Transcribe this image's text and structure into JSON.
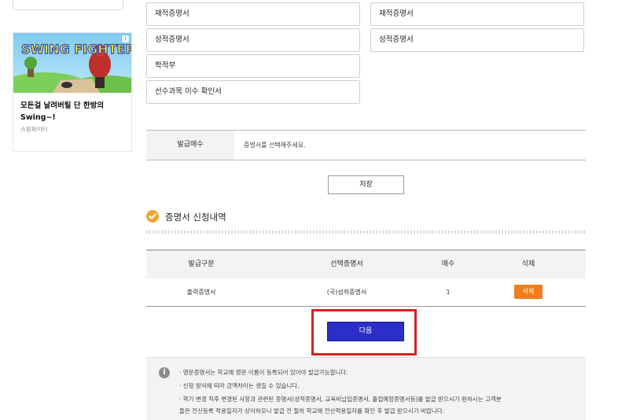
{
  "sidebar": {
    "ad": {
      "game_logo": "SWING FIGHTER",
      "info_badge": "i",
      "title": "모든걸 날려버릴 단 한방의 Swing~!",
      "advertiser": "스윙파이터"
    }
  },
  "certificates": {
    "left": [
      "재적증명서",
      "성적증명서",
      "학적부",
      "선수과목 이수 확인서"
    ],
    "right": [
      "재적증명서",
      "성적증명서"
    ]
  },
  "issue": {
    "label": "발급매수",
    "value": "증명서를 선택해주세요."
  },
  "save_label": "저장",
  "history": {
    "title": "증명서 신청내역",
    "headers": [
      "발급구분",
      "선택증명서",
      "매수",
      "삭제"
    ],
    "rows": [
      {
        "type": "출력증명서",
        "certificate": "(국)성적증명서",
        "count": "1",
        "delete_label": "삭제"
      }
    ]
  },
  "next_label": "다음",
  "notice": {
    "lines": [
      "·  영문증명서는 학교에 영문 이름이 등록되어 있어야 발급가능합니다.",
      "·  신청 방식에 따라 금액차이는 생길 수 있습니다.",
      "·  학기 변경 직후 변경된 사항과 관련된 증명서(성적증명서, 교육비납입증명서, 졸업예정증명서등)를 발급 받으시기 원하시는 고객분",
      "   들은 전산등록 적용일자가 상이하오니 발급 전 필히 학교에 전산적용일자를 확인 후 발급 받으시기 바랍니다."
    ]
  },
  "colors": {
    "accent_orange": "#f07d1a",
    "primary_blue": "#2b2fc7",
    "highlight_red": "#d42222",
    "check_icon": "#f0a534"
  },
  "icons": {
    "section": "check-circle-icon",
    "notice": "info-icon"
  }
}
